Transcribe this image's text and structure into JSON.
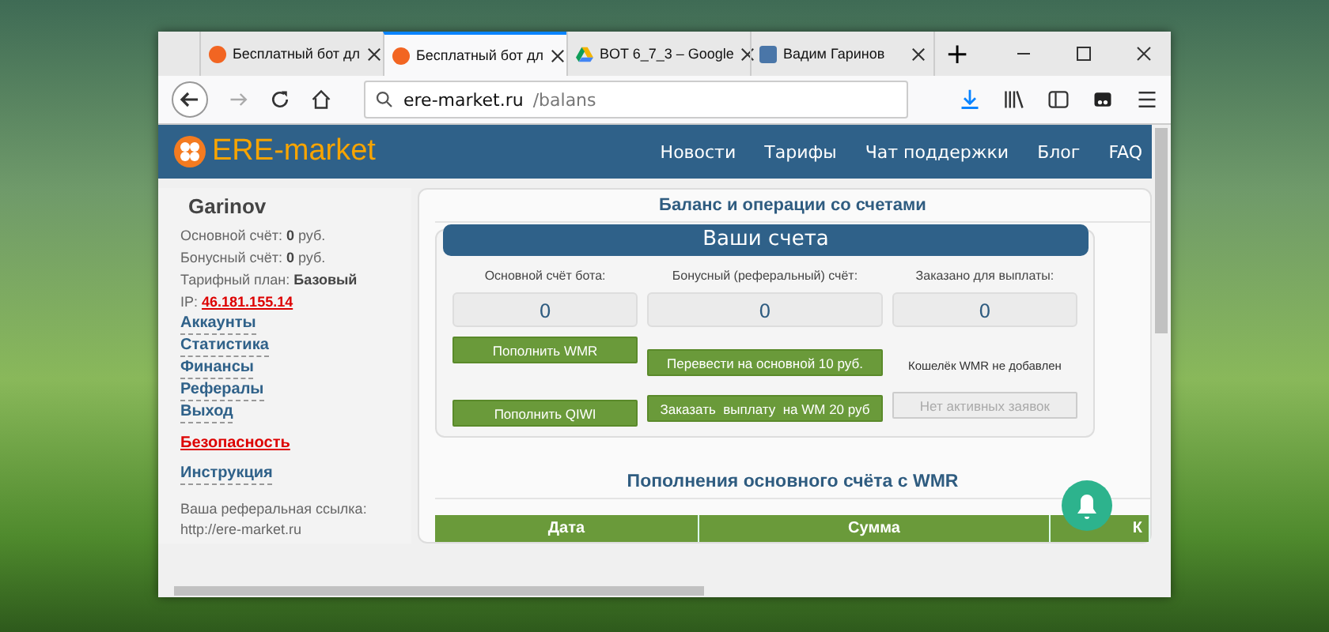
{
  "browser": {
    "tabs": [
      {
        "title": "Бесплатный бот дл",
        "selected": false
      },
      {
        "title": "Бесплатный бот дл",
        "selected": true
      },
      {
        "title": "BOT 6_7_3 – Google",
        "selected": false
      },
      {
        "title": "Вадим Гаринов",
        "selected": false
      }
    ],
    "new_tab": "+",
    "url_host": "ere-market.ru",
    "url_path": "/balans"
  },
  "site": {
    "logo": "ERE-market",
    "nav": [
      "Новости",
      "Тарифы",
      "Чат поддержки",
      "Блог",
      "FAQ"
    ]
  },
  "sidebar": {
    "username": "Garinov",
    "stats": [
      {
        "label": "Основной счёт:",
        "value": "0",
        "unit": "руб."
      },
      {
        "label": "Бонусный счёт:",
        "value": "0",
        "unit": "руб."
      },
      {
        "label": "Тарифный план:",
        "value": "Базовый"
      }
    ],
    "ip_label": "IP:",
    "ip": "46.181.155.14",
    "links": [
      {
        "text": "Аккаунты",
        "kind": "normal"
      },
      {
        "text": "Статистика",
        "kind": "normal"
      },
      {
        "text": "Финансы",
        "kind": "normal"
      },
      {
        "text": "Рефералы",
        "kind": "normal"
      },
      {
        "text": "Выход",
        "kind": "normal"
      },
      {
        "text": "Безопасность",
        "kind": "alert"
      },
      {
        "text": "Инструкция",
        "kind": "normal"
      }
    ],
    "ref_label": "Ваша реферальная ссылка:",
    "ref_link": "http://ere-market.ru"
  },
  "main": {
    "title": "Баланс и операции со счетами",
    "accounts_header": "Ваши счета",
    "accounts": [
      {
        "label": "Основной счёт бота:",
        "value": "0",
        "actions": [
          {
            "text": "Пополнить WMR",
            "disabled": false
          },
          {
            "text": "Пополнить QIWI",
            "disabled": false
          }
        ]
      },
      {
        "label": "Бонусный (реферальный) счёт:",
        "value": "0",
        "actions": [
          {
            "text": "Перевести на основной 10 руб.",
            "disabled": false
          },
          {
            "text": "Заказать  выплату  на WM 20 руб",
            "disabled": false
          }
        ]
      },
      {
        "label": "Заказано для выплаты:",
        "value": "0",
        "note": "Кошелёк WMR не добавлен",
        "actions": [
          {
            "text": "Нет активных заявок",
            "disabled": true
          }
        ]
      }
    ],
    "deposits_title": "Пополнения основного счёта с WMR",
    "table": {
      "columns": [
        "Дата",
        "Сумма",
        "К"
      ]
    }
  }
}
